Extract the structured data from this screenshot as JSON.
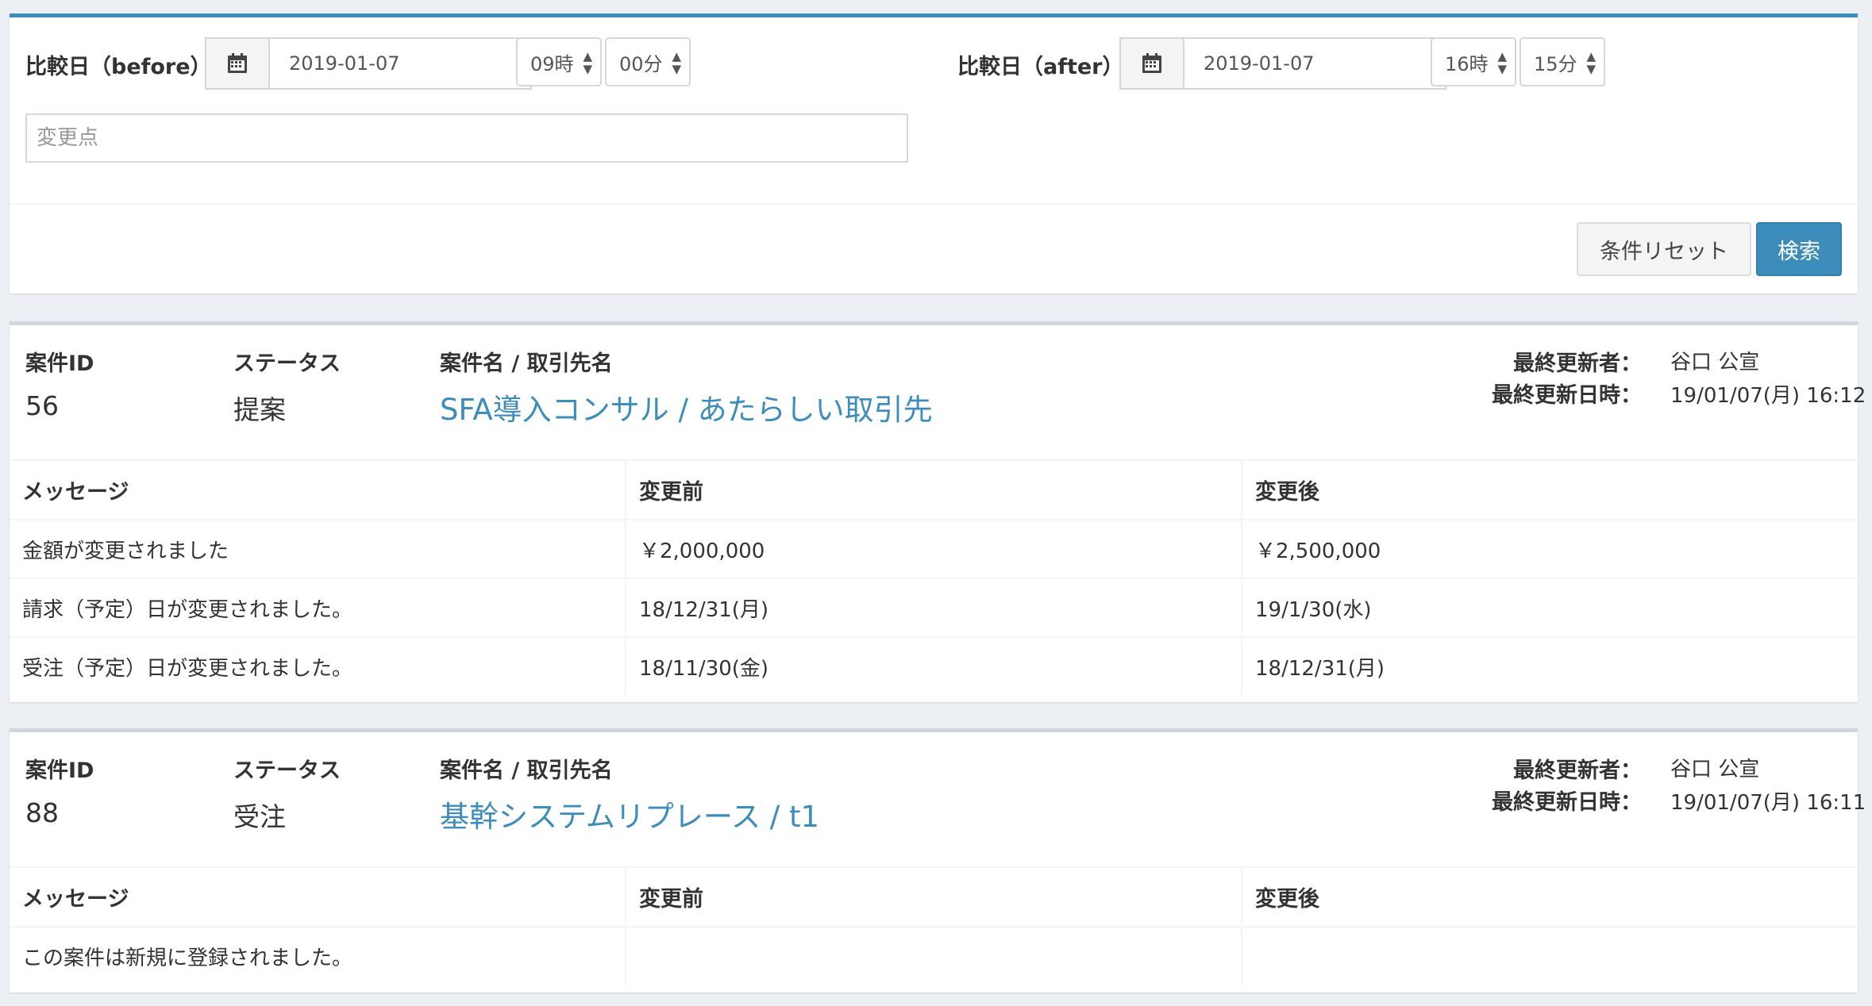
{
  "search": {
    "before_label": "比較日（before）",
    "before_date": "2019-01-07",
    "before_hour": "09時",
    "before_minute": "00分",
    "after_label": "比較日（after）",
    "after_date": "2019-01-07",
    "after_hour": "16時",
    "after_minute": "15分",
    "change_point_placeholder": "変更点",
    "reset_label": "条件リセット",
    "search_label": "検索"
  },
  "labels": {
    "case_id": "案件ID",
    "status": "ステータス",
    "case_name": "案件名 / 取引先名",
    "last_updater": "最終更新者：",
    "last_updated": "最終更新日時：",
    "message": "メッセージ",
    "before": "変更前",
    "after": "変更後"
  },
  "colors": {
    "primary": "#3c8dbc",
    "background": "#ecf0f5"
  },
  "cases": [
    {
      "id": "56",
      "status": "提案",
      "name": "SFA導入コンサル / あたらしい取引先",
      "updater": "谷口 公宣",
      "updated_at": "19/01/07(月) 16:12",
      "changes": [
        {
          "message": "金額が変更されました",
          "before": "￥2,000,000",
          "after": "￥2,500,000"
        },
        {
          "message": "請求（予定）日が変更されました。",
          "before": "18/12/31(月)",
          "after": "19/1/30(水)"
        },
        {
          "message": "受注（予定）日が変更されました。",
          "before": "18/11/30(金)",
          "after": "18/12/31(月)"
        }
      ]
    },
    {
      "id": "88",
      "status": "受注",
      "name": "基幹システムリプレース / t1",
      "updater": "谷口 公宣",
      "updated_at": "19/01/07(月) 16:11",
      "changes": [
        {
          "message": "この案件は新規に登録されました。",
          "before": "",
          "after": ""
        }
      ]
    }
  ]
}
